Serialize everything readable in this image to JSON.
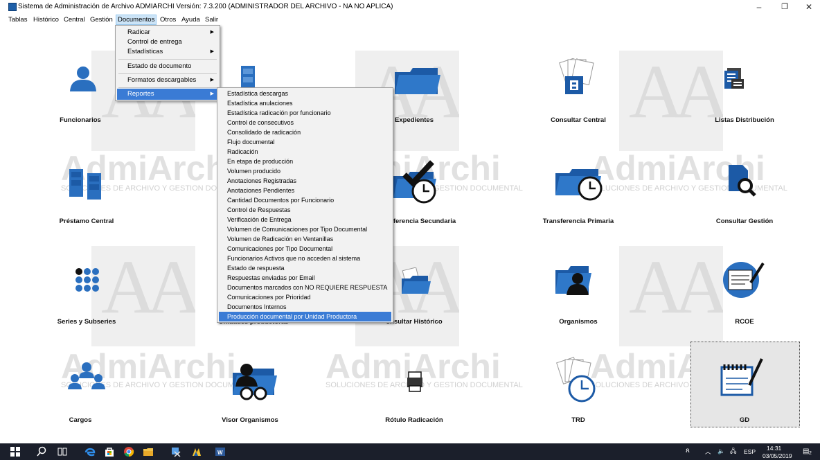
{
  "window": {
    "title": "Sistema de Administración de Archivo ADMIARCHI Versión: 7.3.200 (ADMINISTRADOR DEL ARCHIVO - NA NO APLICA)",
    "minimize": "–",
    "maximize": "❐",
    "close": "✕"
  },
  "menubar": [
    "Tablas",
    "Histórico",
    "Central",
    "Gestión",
    "Documentos",
    "Otros",
    "Ayuda",
    "Salir"
  ],
  "watermark": {
    "text": "AdmiArchi",
    "subtitle": "SOLUCIONES DE ARCHIVO Y GESTION DOCUMENTAL",
    "letters": "AA"
  },
  "tiles": [
    "Funcionarios",
    "Expedientes",
    "Consultar Central",
    "Listas Distribución",
    "Préstamo Central",
    "ferencia Secundaria",
    "Transferencia Primaria",
    "Consultar Gestión",
    "Series y Subseries",
    "Unidades productoras",
    "onsultar Histórico",
    "Organismos",
    "RCOE",
    "Cargos",
    "Visor Organismos",
    "Rótulo Radicación",
    "TRD",
    "GD"
  ],
  "documentos_menu": [
    {
      "label": "Radicar",
      "submenu": true
    },
    {
      "label": "Control de entrega",
      "submenu": false
    },
    {
      "label": "Estadísticas",
      "submenu": true
    },
    {
      "label": "Estado de documento",
      "submenu": false
    },
    {
      "label": "Formatos descargables",
      "submenu": true
    },
    {
      "label": "Reportes",
      "submenu": true
    }
  ],
  "reportes_menu": [
    "Estadística descargas",
    "Estadística anulaciones",
    "Estadística radicación por funcionario",
    "Control de consecutivos",
    "Consolidado de radicación",
    "Flujo documental",
    "Radicación",
    "En etapa de producción",
    "Volumen producido",
    "Anotaciones Registradas",
    "Anotaciones Pendientes",
    "Cantidad Documentos por Funcionario",
    "Control de Respuestas",
    "Verificación de Entrega",
    "Volumen de Comunicaciones por Tipo Documental",
    "Volumen de Radicación en Ventanillas",
    "Comunicaciones por Tipo Documental",
    "Funcionarios Activos que no acceden al sistema",
    "Estado de respuesta",
    "Respuestas enviadas por Email",
    "Documentos marcados con NO REQUIERE RESPUESTA",
    "Comunicaciones por Prioridad",
    "Documentos Internos",
    "Producción documental por Unidad Productora"
  ],
  "taskbar": {
    "lang": "ESP",
    "time": "14:31",
    "date": "03/05/2019",
    "notif_count": "2",
    "apps": [
      "windows-start",
      "search",
      "task-view",
      "edge",
      "store",
      "chrome",
      "file-explorer",
      "snipping-tool",
      "admiarchi",
      "word"
    ]
  },
  "colors": {
    "accent": "#2a6fbf",
    "menu_highlight": "#3a7bd5",
    "taskbar": "#1b1f2b"
  }
}
